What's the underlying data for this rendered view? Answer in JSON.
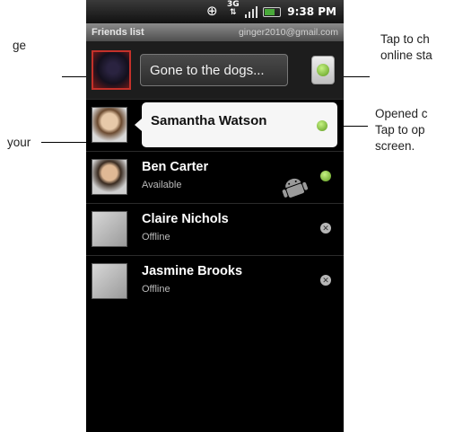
{
  "callouts": {
    "left_top": "ge",
    "left_mid": "your",
    "right_top_line1": "Tap to ch",
    "right_top_line2": "online sta",
    "right_mid_line1": "Opened c",
    "right_mid_line2": "Tap to op",
    "right_mid_line3": "screen."
  },
  "statusbar": {
    "gps_icon": "gps-icon",
    "network": "3G",
    "time": "9:38 PM"
  },
  "titlebar": {
    "title": "Friends list",
    "account": "ginger2010@gmail.com"
  },
  "me": {
    "status_message": "Gone to the dogs...",
    "online_color": "#7cc13a"
  },
  "friends": [
    {
      "name": "Samantha  Watson",
      "status": "",
      "presence": "online"
    },
    {
      "name": "Ben Carter",
      "status": "Available",
      "presence": "online"
    },
    {
      "name": "Claire Nichols",
      "status": "Offline",
      "presence": "offline"
    },
    {
      "name": "Jasmine Brooks",
      "status": "Offline",
      "presence": "offline"
    }
  ]
}
